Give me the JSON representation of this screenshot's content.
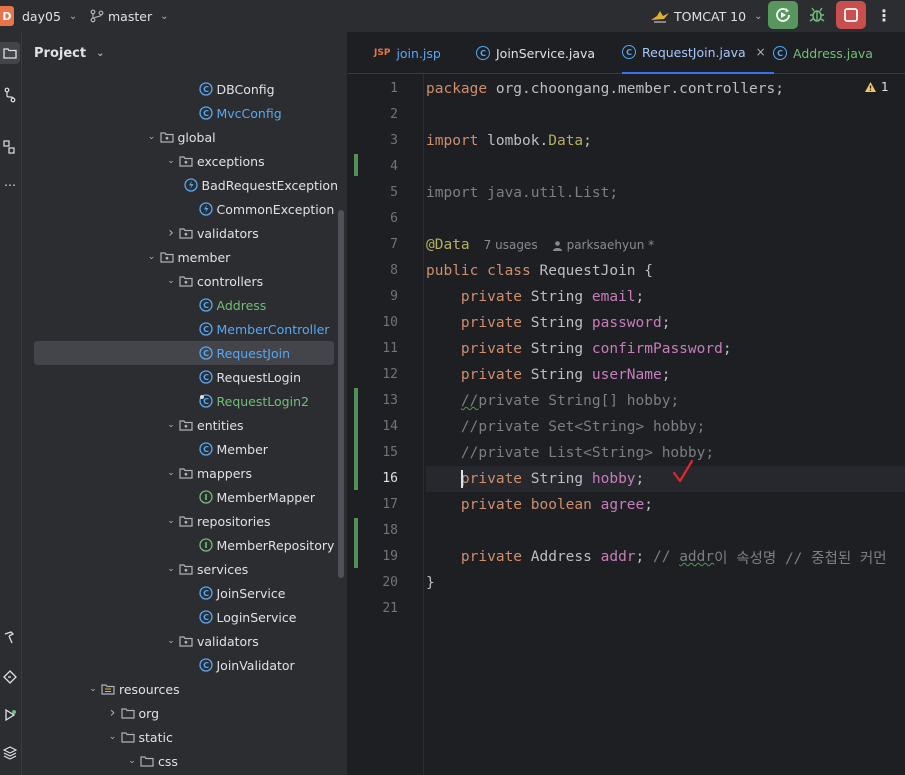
{
  "titlebar": {
    "project_badge": "D",
    "project_name": "day05",
    "branch": "master",
    "run_config": "TOMCAT 10"
  },
  "project_panel": {
    "title": "Project",
    "tree": [
      {
        "label": "DBConfig",
        "indent": 9,
        "type": "class",
        "color": "normal"
      },
      {
        "label": "MvcConfig",
        "indent": 9,
        "type": "class",
        "color": "blue"
      },
      {
        "label": "global",
        "indent": 7,
        "type": "package",
        "expanded": true
      },
      {
        "label": "exceptions",
        "indent": 8,
        "type": "package",
        "expanded": true
      },
      {
        "label": "BadRequestException",
        "indent": 9,
        "type": "exception"
      },
      {
        "label": "CommonException",
        "indent": 9,
        "type": "exception"
      },
      {
        "label": "validators",
        "indent": 8,
        "type": "package",
        "expanded": false
      },
      {
        "label": "member",
        "indent": 7,
        "type": "package",
        "expanded": true
      },
      {
        "label": "controllers",
        "indent": 8,
        "type": "package",
        "expanded": true
      },
      {
        "label": "Address",
        "indent": 9,
        "type": "class",
        "color": "green"
      },
      {
        "label": "MemberController",
        "indent": 9,
        "type": "class",
        "color": "blue"
      },
      {
        "label": "RequestJoin",
        "indent": 9,
        "type": "class",
        "color": "blue",
        "selected": true
      },
      {
        "label": "RequestLogin",
        "indent": 9,
        "type": "class",
        "color": "normal"
      },
      {
        "label": "RequestLogin2",
        "indent": 9,
        "type": "class-new",
        "color": "green"
      },
      {
        "label": "entities",
        "indent": 8,
        "type": "package",
        "expanded": true
      },
      {
        "label": "Member",
        "indent": 9,
        "type": "class",
        "color": "normal"
      },
      {
        "label": "mappers",
        "indent": 8,
        "type": "package",
        "expanded": true
      },
      {
        "label": "MemberMapper",
        "indent": 9,
        "type": "interface"
      },
      {
        "label": "repositories",
        "indent": 8,
        "type": "package",
        "expanded": true
      },
      {
        "label": "MemberRepository",
        "indent": 9,
        "type": "interface"
      },
      {
        "label": "services",
        "indent": 8,
        "type": "package",
        "expanded": true
      },
      {
        "label": "JoinService",
        "indent": 9,
        "type": "class",
        "color": "normal"
      },
      {
        "label": "LoginService",
        "indent": 9,
        "type": "class",
        "color": "normal"
      },
      {
        "label": "validators",
        "indent": 8,
        "type": "package",
        "expanded": true
      },
      {
        "label": "JoinValidator",
        "indent": 9,
        "type": "class",
        "color": "normal"
      },
      {
        "label": "resources",
        "indent": 4,
        "type": "resources",
        "expanded": true
      },
      {
        "label": "org",
        "indent": 5,
        "type": "folder",
        "expanded": false
      },
      {
        "label": "static",
        "indent": 5,
        "type": "folder",
        "expanded": true
      },
      {
        "label": "css",
        "indent": 6,
        "type": "folder",
        "expanded": true
      }
    ]
  },
  "editor": {
    "tabs": [
      {
        "label": "join.jsp",
        "icon": "JSP",
        "color": "blue"
      },
      {
        "label": "JoinService.java",
        "icon": "class"
      },
      {
        "label": "RequestJoin.java",
        "icon": "class",
        "active": true,
        "close": "×"
      },
      {
        "label": "Address.java",
        "icon": "class",
        "color": "green"
      }
    ],
    "warning_count": "1",
    "line_numbers": [
      "1",
      "2",
      "3",
      "4",
      "5",
      "6",
      "7",
      "8",
      "9",
      "10",
      "11",
      "12",
      "13",
      "14",
      "15",
      "16",
      "17",
      "18",
      "19",
      "20",
      "21"
    ],
    "current_line": "16",
    "code": {
      "l1_kw": "package",
      "l1_rest": " org.choongang.member.controllers;",
      "l3_kw": "import",
      "l3_pkg": " lombok.",
      "l3_ann": "Data",
      "l3_end": ";",
      "l5": "import java.util.List;",
      "l7_ann": "@Data",
      "l7_usages": "7 usages",
      "l7_author": "parksaehyun *",
      "l8_kw": "public class",
      "l8_rest": " RequestJoin {",
      "l9_kw": "private",
      "l9_type": " String ",
      "l9_fld": "email",
      "l9_end": ";",
      "l10_kw": "private",
      "l10_type": " String ",
      "l10_fld": "password",
      "l10_end": ";",
      "l11_kw": "private",
      "l11_type": " String ",
      "l11_fld": "confirmPassword",
      "l11_end": ";",
      "l12_kw": "private",
      "l12_type": " String ",
      "l12_fld": "userName",
      "l12_end": ";",
      "l13_pre": "//",
      "l13": "private String[] hobby;",
      "l14": "//private Set<String> hobby;",
      "l15": "//private List<String> hobby;",
      "l16_kw": "private",
      "l16_type": " String ",
      "l16_fld": "hobby",
      "l16_end": ";",
      "l17_kw": "private boolean",
      "l17_fld": " agree",
      "l17_end": ";",
      "l19_kw": "private",
      "l19_type": " Address ",
      "l19_fld": "addr",
      "l19_end": "; ",
      "l19_cmt1": "// ",
      "l19_cmt2": "addr",
      "l19_cmt3": "이 속성명 // 중첩된 커먼",
      "l20": "}"
    }
  }
}
